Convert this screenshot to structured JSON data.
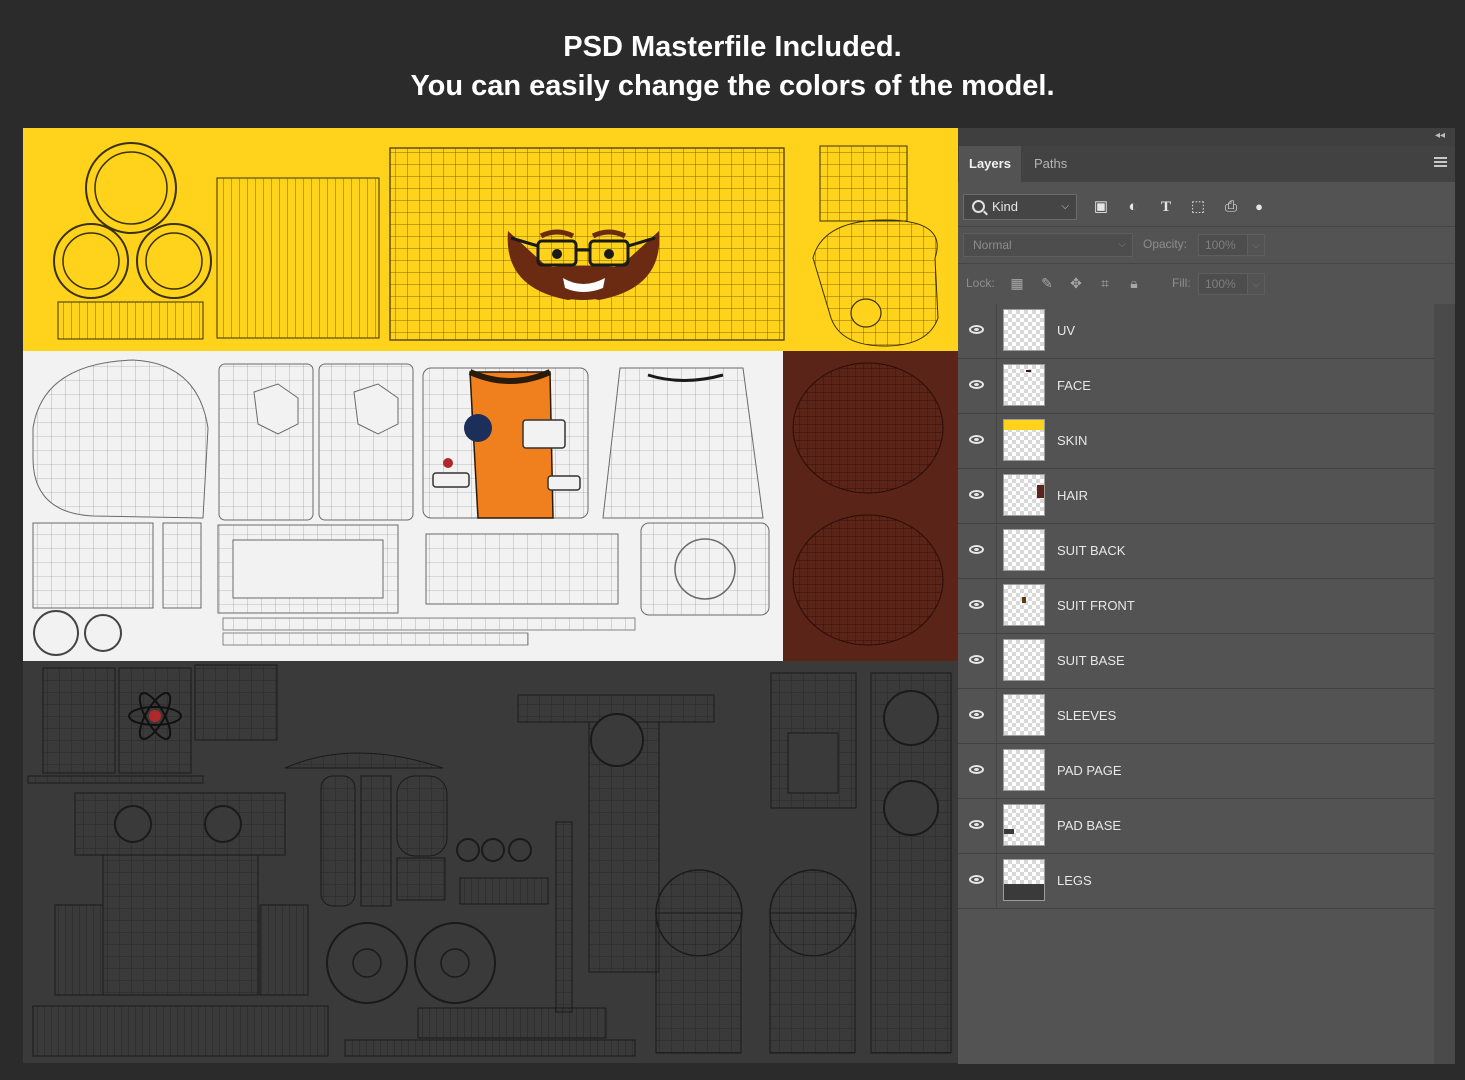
{
  "headline": {
    "line1": "PSD Masterfile Included.",
    "line2": "You can easily change the colors of the model."
  },
  "panel": {
    "tabs": [
      {
        "label": "Layers",
        "active": true
      },
      {
        "label": "Paths",
        "active": false
      }
    ],
    "filter": {
      "kind_label": "Kind",
      "icons": [
        "image-filter-icon",
        "adjustment-filter-icon",
        "type-filter-icon",
        "shape-filter-icon",
        "smart-object-filter-icon",
        "filter-toggle-icon"
      ]
    },
    "blend_mode": "Normal",
    "opacity_label": "Opacity:",
    "opacity_value": "100%",
    "lock_label": "Lock:",
    "lock_icons": [
      "lock-transparent-pixels-icon",
      "lock-image-pixels-icon",
      "lock-position-icon",
      "lock-artboard-icon",
      "lock-all-icon"
    ],
    "fill_label": "Fill:",
    "fill_value": "100%",
    "layers": [
      {
        "name": "UV",
        "visible": true,
        "thumb": "blank"
      },
      {
        "name": "FACE",
        "visible": true,
        "thumb": "face"
      },
      {
        "name": "SKIN",
        "visible": true,
        "thumb": "skin",
        "thumb_color": "#ffd21c"
      },
      {
        "name": "HAIR",
        "visible": true,
        "thumb": "hair",
        "thumb_color": "#5b2418"
      },
      {
        "name": "SUIT BACK",
        "visible": true,
        "thumb": "blank"
      },
      {
        "name": "SUIT FRONT",
        "visible": true,
        "thumb": "suit-front"
      },
      {
        "name": "SUIT BASE",
        "visible": true,
        "thumb": "blank"
      },
      {
        "name": "SLEEVES",
        "visible": true,
        "thumb": "blank"
      },
      {
        "name": "PAD PAGE",
        "visible": true,
        "thumb": "blank"
      },
      {
        "name": "PAD BASE",
        "visible": true,
        "thumb": "pad-base"
      },
      {
        "name": "LEGS",
        "visible": true,
        "thumb": "legs",
        "thumb_color": "#3a3a3a"
      }
    ]
  },
  "colors": {
    "skin_yellow": "#ffd21c",
    "hair_brown": "#5b2418",
    "suit_white": "#f2f2f2",
    "legs_dark": "#3a3a3a",
    "vest_orange": "#f07f1e"
  }
}
